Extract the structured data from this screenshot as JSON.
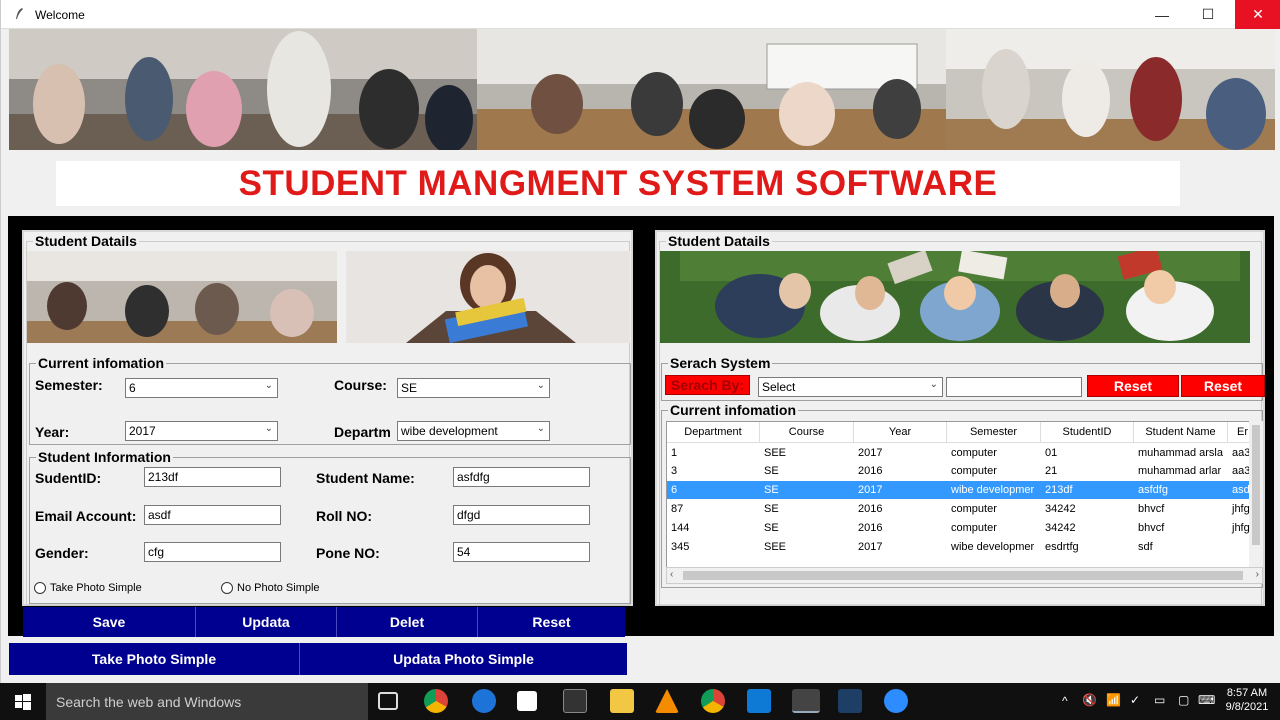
{
  "window": {
    "title": "Welcome"
  },
  "banner_title": "STUDENT MANGMENT SYSTEM SOFTWARE",
  "left_panel": {
    "group_title": "Student Datails",
    "current_info": {
      "title": "Current infomation",
      "semester_label": "Semester:",
      "semester_value": "6",
      "course_label": "Course:",
      "course_value": "SE",
      "year_label": "Year:",
      "year_value": "2017",
      "department_label": "Departm",
      "department_value": "wibe development"
    },
    "student_info": {
      "title": "Student Information",
      "id_label": "SudentID:",
      "id_value": "213df",
      "name_label": "Student Name:",
      "name_value": "asfdfg",
      "email_label": "Email Account:",
      "email_value": "asdf",
      "roll_label": "Roll NO:",
      "roll_value": "dfgd",
      "gender_label": "Gender:",
      "gender_value": "cfg",
      "phone_label": "Pone NO:",
      "phone_value": "54",
      "radio_take": "Take Photo Simple",
      "radio_no": "No Photo Simple"
    },
    "buttons": {
      "save": "Save",
      "update": "Updata",
      "delete": "Delet",
      "reset": "Reset"
    },
    "photo_buttons": {
      "take": "Take Photo Simple",
      "update": "Updata Photo Simple"
    }
  },
  "right_panel": {
    "group_title": "Student Datails",
    "search": {
      "title": "Serach System",
      "by_label": "Serach By:",
      "select_value": "Select",
      "input_value": "",
      "btn1": "Reset",
      "btn2": "Reset"
    },
    "table": {
      "title": "Current infomation",
      "columns": [
        "Department",
        "Course",
        "Year",
        "Semester",
        "StudentID",
        "Student Name",
        "Er"
      ],
      "rows": [
        [
          "1",
          "SEE",
          "2017",
          "computer",
          "01",
          "muhammad arsla",
          "aa3"
        ],
        [
          "3",
          "SE",
          "2016",
          "computer",
          "21",
          "muhammad arlar",
          "aa3"
        ],
        [
          "6",
          "SE",
          "2017",
          "wibe developmer",
          "213df",
          "asfdfg",
          "asd"
        ],
        [
          "87",
          "SE",
          "2016",
          "computer",
          "34242",
          "bhvcf",
          "jhfg"
        ],
        [
          "144",
          "SE",
          "2016",
          "computer",
          "34242",
          "bhvcf",
          "jhfg"
        ],
        [
          "345",
          "SEE",
          "2017",
          "wibe developmer",
          "esdrtfg",
          "sdf",
          ""
        ]
      ],
      "selected_row": 2
    }
  },
  "taskbar": {
    "search_placeholder": "Search the web and Windows",
    "time": "8:57 AM",
    "date": "9/8/2021"
  },
  "colors": {
    "title_red": "#e01919",
    "button_blue": "#000090",
    "reset_red": "#ff0000",
    "select_blue": "#3399ff"
  }
}
